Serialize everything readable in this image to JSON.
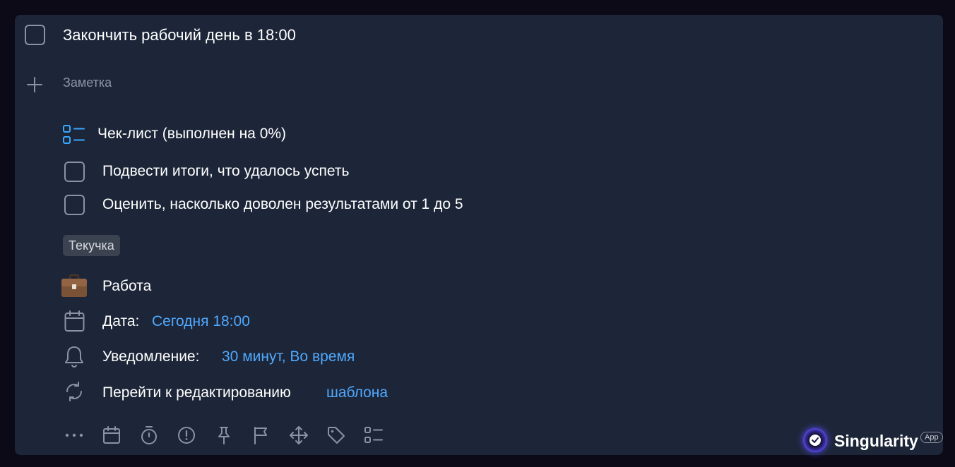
{
  "task": {
    "title": "Закончить рабочий день в 18:00",
    "note_placeholder": "Заметка"
  },
  "checklist": {
    "header": "Чек-лист (выполнен на 0%)",
    "items": [
      {
        "label": "Подвести итоги, что удалось успеть"
      },
      {
        "label": "Оценить, насколько доволен результатами от 1 до 5"
      }
    ]
  },
  "tag": "Текучка",
  "project": {
    "label": "Работа",
    "icon": "briefcase-icon"
  },
  "date": {
    "label": "Дата:",
    "value": "Сегодня 18:00"
  },
  "notification": {
    "label": "Уведомление:",
    "value": "30 минут, Во время"
  },
  "template": {
    "label": "Перейти к редактированию",
    "link": "шаблона"
  },
  "toolbar": [
    "more-icon",
    "calendar-icon",
    "timer-icon",
    "priority-icon",
    "pin-icon",
    "flag-icon",
    "move-icon",
    "tag-icon",
    "checklist-icon"
  ],
  "brand": {
    "name": "Singularity",
    "badge": "App"
  },
  "colors": {
    "background": "#0b0a16",
    "card": "#1d2638",
    "accent": "#4fa9ff",
    "checklist_icon": "#3aa8ff"
  }
}
